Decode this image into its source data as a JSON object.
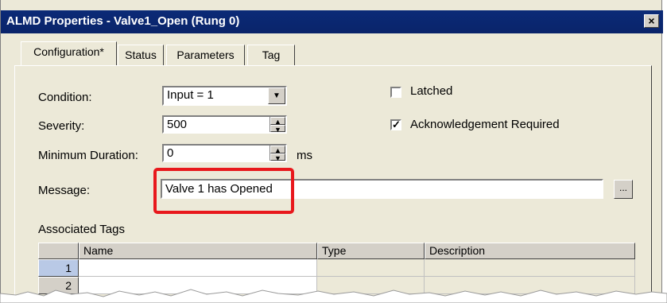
{
  "window": {
    "title": "ALMD Properties - Valve1_Open (Rung 0)",
    "close_label": "×"
  },
  "tabs": [
    {
      "label": "Configuration*",
      "active": true
    },
    {
      "label": "Status",
      "active": false
    },
    {
      "label": "Parameters",
      "active": false
    },
    {
      "label": "Tag",
      "active": false
    }
  ],
  "form": {
    "condition_label": "Condition:",
    "condition_value": "Input = 1",
    "severity_label": "Severity:",
    "severity_value": "500",
    "min_duration_label": "Minimum Duration:",
    "min_duration_value": "0",
    "min_duration_unit": "ms",
    "message_label": "Message:",
    "message_value": "Valve 1 has Opened",
    "browse_label": "...",
    "latched_label": "Latched",
    "latched_checked": false,
    "ack_label": "Acknowledgement Required",
    "ack_checked": true
  },
  "associated_tags": {
    "heading": "Associated Tags",
    "columns": [
      "Name",
      "Type",
      "Description"
    ],
    "rows": [
      "1",
      "2"
    ]
  },
  "colors": {
    "highlight": "#e8181c",
    "titlebar": "#0a246a"
  }
}
